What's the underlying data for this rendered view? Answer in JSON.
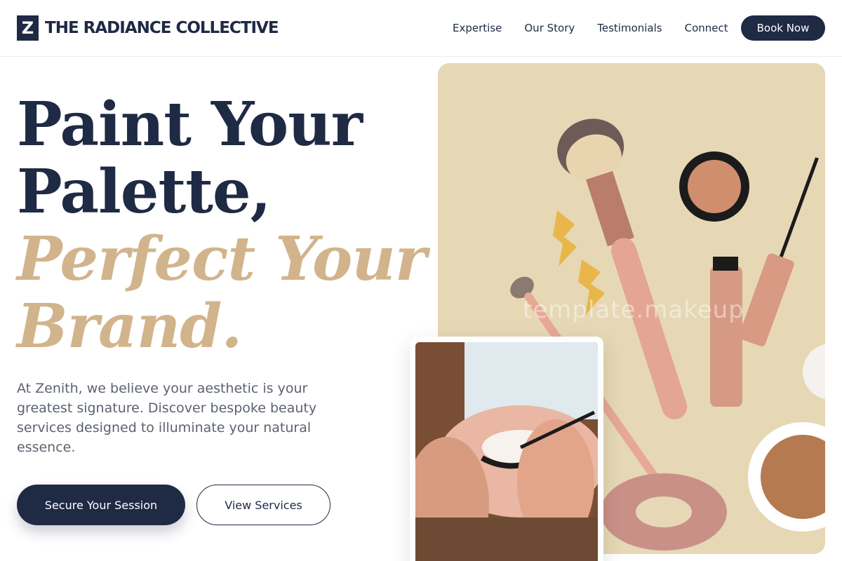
{
  "brand": {
    "logo_letter": "Z",
    "name": "THE RADIANCE COLLECTIVE"
  },
  "nav": {
    "items": [
      "Expertise",
      "Our Story",
      "Testimonials",
      "Connect"
    ],
    "cta_label": "Book Now"
  },
  "hero": {
    "headline_lines": [
      "Paint Your",
      "Palette,",
      "Perfect Your",
      "Brand."
    ],
    "description": "At Zenith, we believe your aesthetic is your greatest signature. Discover bespoke beauty services designed to illuminate your natural essence.",
    "primary_cta": "Secure Your Session",
    "secondary_cta": "View Services"
  },
  "image": {
    "watermark": "template.makeup"
  },
  "colors": {
    "navy": "#1f2a44",
    "gold": "#d2b48c",
    "image_bg": "#e6d8b5"
  }
}
